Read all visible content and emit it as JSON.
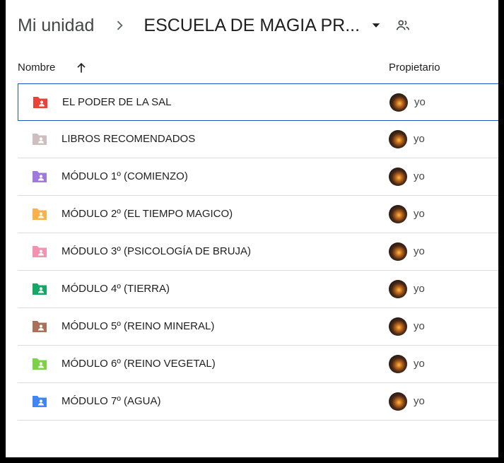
{
  "breadcrumb": {
    "root": "Mi unidad",
    "current": "ESCUELA DE MAGIA PR...",
    "separator_icon": "chevron-right-icon",
    "dropdown_icon": "caret-down-icon",
    "shared_icon": "people-icon"
  },
  "columns": {
    "name": "Nombre",
    "owner": "Propietario",
    "sort_icon": "arrow-up-icon"
  },
  "rows": [
    {
      "name": "EL PODER DE LA SAL",
      "owner": "yo",
      "color": "#ea4335",
      "selected": true
    },
    {
      "name": "LIBROS RECOMENDADOS",
      "owner": "yo",
      "color": "#cdbfbf",
      "selected": false
    },
    {
      "name": "MÓDULO 1º (COMIENZO)",
      "owner": "yo",
      "color": "#a179dc",
      "selected": false
    },
    {
      "name": "MÓDULO 2º (EL TIEMPO MAGICO)",
      "owner": "yo",
      "color": "#fbb04c",
      "selected": false
    },
    {
      "name": "MÓDULO 3º (PSICOLOGÍA DE BRUJA)",
      "owner": "yo",
      "color": "#f291b0",
      "selected": false
    },
    {
      "name": "MÓDULO 4º (TIERRA)",
      "owner": "yo",
      "color": "#16a765",
      "selected": false
    },
    {
      "name": "MÓDULO 5º (REINO MINERAL)",
      "owner": "yo",
      "color": "#a9705a",
      "selected": false
    },
    {
      "name": "MÓDULO 6º (REINO VEGETAL)",
      "owner": "yo",
      "color": "#7bd148",
      "selected": false
    },
    {
      "name": "MÓDULO 7º (AGUA)",
      "owner": "yo",
      "color": "#4285f4",
      "selected": false
    }
  ]
}
